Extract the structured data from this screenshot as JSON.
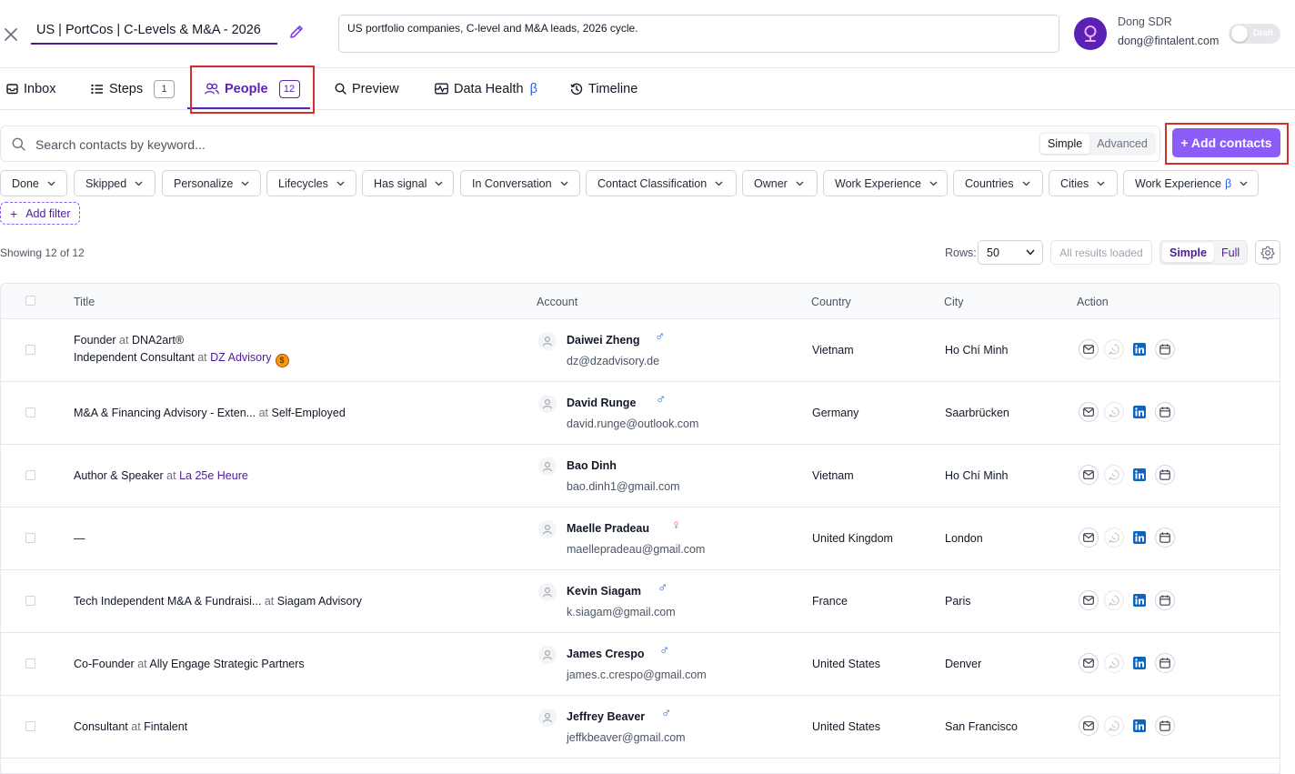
{
  "sequence": {
    "title": "US | PortCos | C-Levels & M&A - 2026",
    "description": "US portfolio companies, C-level and M&A leads, 2026 cycle."
  },
  "user": {
    "name": "Dong SDR",
    "email": "dong@fintalent.com",
    "status_label": "Draft",
    "avatar_color": "#5b21b6"
  },
  "tabs": [
    {
      "label": "Inbox",
      "icon": "inbox-icon"
    },
    {
      "label": "Steps",
      "count": "1",
      "icon": "list-icon"
    },
    {
      "label": "People",
      "count": "12",
      "icon": "people-icon",
      "active": true
    },
    {
      "label": "Preview",
      "icon": "search-icon"
    },
    {
      "label": "Data Health",
      "suffix": "β",
      "icon": "pulse-icon"
    },
    {
      "label": "Timeline",
      "icon": "history-icon"
    }
  ],
  "search": {
    "placeholder": "Search contacts by keyword...",
    "mode_simple": "Simple",
    "mode_advanced": "Advanced"
  },
  "add_contacts_label": "+ Add contacts",
  "filters": [
    "Done",
    "Skipped",
    "Personalize",
    "Lifecycles",
    "Has signal",
    "In Conversation",
    "Contact Classification",
    "Owner",
    "Work Experience",
    "Countries",
    "Cities",
    "Work Experience"
  ],
  "filter_beta_suffix": "β",
  "add_filter_label": "Add filter",
  "add_filter_plus": "+",
  "showing": "Showing 12 of 12",
  "rows": {
    "label": "Rows:",
    "value": "50"
  },
  "all_results_label": "All results loaded",
  "view_simple": "Simple",
  "view_full": "Full",
  "columns": {
    "title": "Title",
    "account": "Account",
    "country": "Country",
    "city": "City",
    "action": "Action"
  },
  "people": [
    {
      "title1": "Founder",
      "at1": "at",
      "company1": "DNA2art®",
      "title2": "Independent Consultant",
      "at2": "at",
      "company2": "DZ Advisory",
      "badge": "$",
      "name": "Daiwei Zheng",
      "gender": "♂",
      "email": "dz@dzadvisory.de",
      "country": "Vietnam",
      "city": "Ho Chí Minh"
    },
    {
      "title1": "M&A & Financing Advisory - Exten...",
      "at1": "at",
      "company1": "Self-Employed",
      "name": "David Runge",
      "gender": "♂",
      "email": "david.runge@outlook.com",
      "country": "Germany",
      "city": "Saarbrücken"
    },
    {
      "title1": "Author & Speaker",
      "at1": "at",
      "company1": "La 25e Heure",
      "company1_link": true,
      "name": "Bao Dinh",
      "email": "bao.dinh1@gmail.com",
      "country": "Vietnam",
      "city": "Ho Chí Minh"
    },
    {
      "title1": "—",
      "name": "Maelle Pradeau",
      "gender": "♀",
      "email": "maellepradeau@gmail.com",
      "country": "United Kingdom",
      "city": "London"
    },
    {
      "title1": "Tech Independent M&A & Fundraisi...",
      "at1": "at",
      "company1": "Siagam Advisory",
      "name": "Kevin Siagam",
      "gender": "♂",
      "email": "k.siagam@gmail.com",
      "country": "France",
      "city": "Paris"
    },
    {
      "title1": "Co-Founder",
      "at1": "at",
      "company1": "Ally Engage Strategic Partners",
      "name": "James Crespo",
      "gender": "♂",
      "email": "james.c.crespo@gmail.com",
      "country": "United States",
      "city": "Denver"
    },
    {
      "title1": "Consultant",
      "at1": "at",
      "company1": "Fintalent",
      "name": "Jeffrey Beaver",
      "gender": "♂",
      "email": "jeffkbeaver@gmail.com",
      "country": "United States",
      "city": "San Francisco"
    }
  ],
  "colors": {
    "accent": "#5b21b6",
    "button": "#8b5cf6",
    "highlight": "#d32f2f",
    "male": "#2563eb",
    "female": "#ec4899",
    "linkedin": "#0a66c2"
  }
}
